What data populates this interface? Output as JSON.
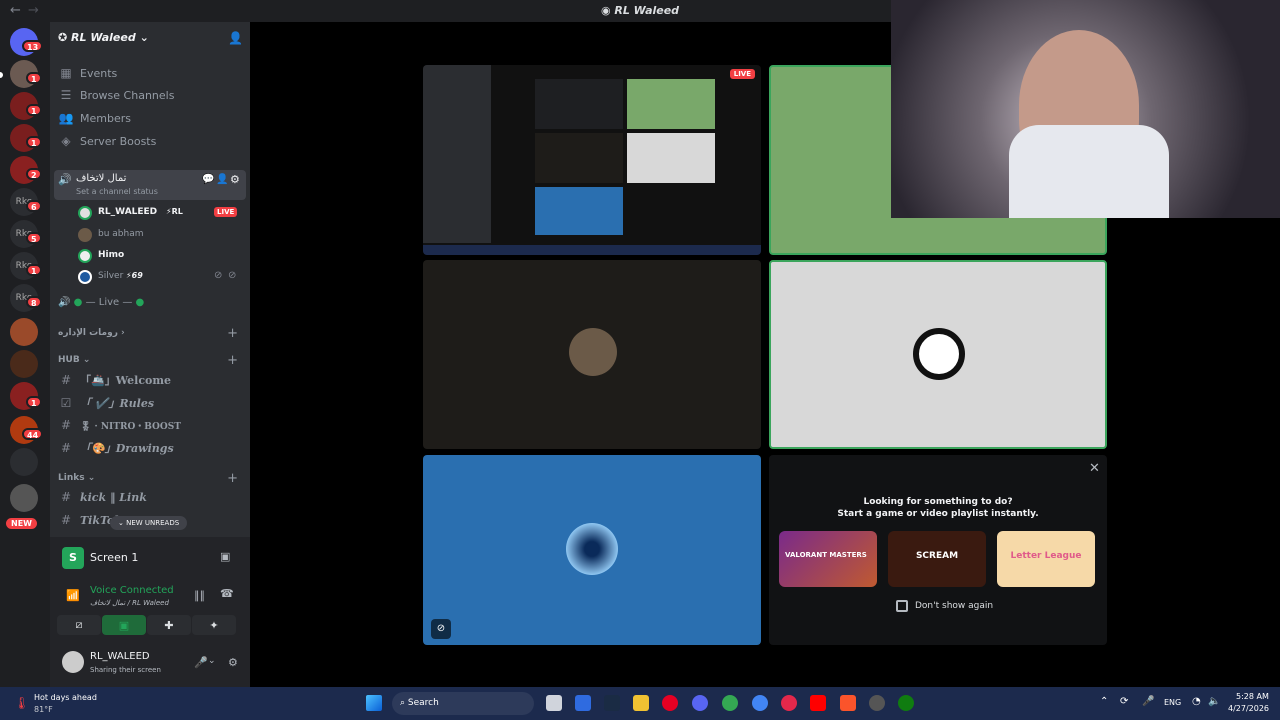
{
  "window": {
    "title": "RL Waleed"
  },
  "servers": {
    "badges": [
      "13",
      "1",
      "1",
      "1",
      "2",
      "6",
      "5",
      "1",
      "8",
      "1",
      "44"
    ],
    "new_label": "NEW",
    "colors": {
      "red": "#f23f43"
    }
  },
  "server_header": {
    "name": "RL Waleed"
  },
  "menu": [
    "Events",
    "Browse Channels",
    "Members",
    "Server Boosts"
  ],
  "voice_channel": {
    "name": "تمال لاتخاف",
    "status": "Set a channel status",
    "users": [
      {
        "name": "RL_WALEED",
        "tag": "RL",
        "live": "LIVE"
      },
      {
        "name": "bu abham"
      },
      {
        "name": "Himo"
      },
      {
        "name": "Silver",
        "tag": "69"
      }
    ]
  },
  "live_channel": {
    "name": "— Live —"
  },
  "categories": {
    "admin": "رومات الإداره",
    "hub": "HUB",
    "links": "Links"
  },
  "hub_channels": [
    "「🚢」Welcome",
    "「 ✔️」Rules",
    "🎖 · NITRO・BOOST",
    "「🎨」Drawings"
  ],
  "link_channels": [
    "kick ‖ Link",
    "TikTok"
  ],
  "new_unreads": "NEW UNREADS",
  "screen_panel": {
    "label": "Screen 1"
  },
  "voice_status": {
    "status": "Voice Connected",
    "channel": "تمال لاتخاف / RL Waleed"
  },
  "user": {
    "name": "RL_WALEED",
    "status": "Sharing their screen"
  },
  "stage": {
    "live_badge": "LIVE",
    "prompt": {
      "line1": "Looking for something to do?",
      "line2": "Start a game or video playlist instantly.",
      "cards": [
        "VALORANT MASTERS",
        "SCREAM",
        "Letter League"
      ],
      "checkbox": "Don't show again"
    }
  },
  "taskbar": {
    "weather_title": "Hot days ahead",
    "weather_temp": "81°F",
    "search": "Search",
    "lang": "ENG",
    "time": "5:28 AM",
    "date": "4/27/2026"
  }
}
